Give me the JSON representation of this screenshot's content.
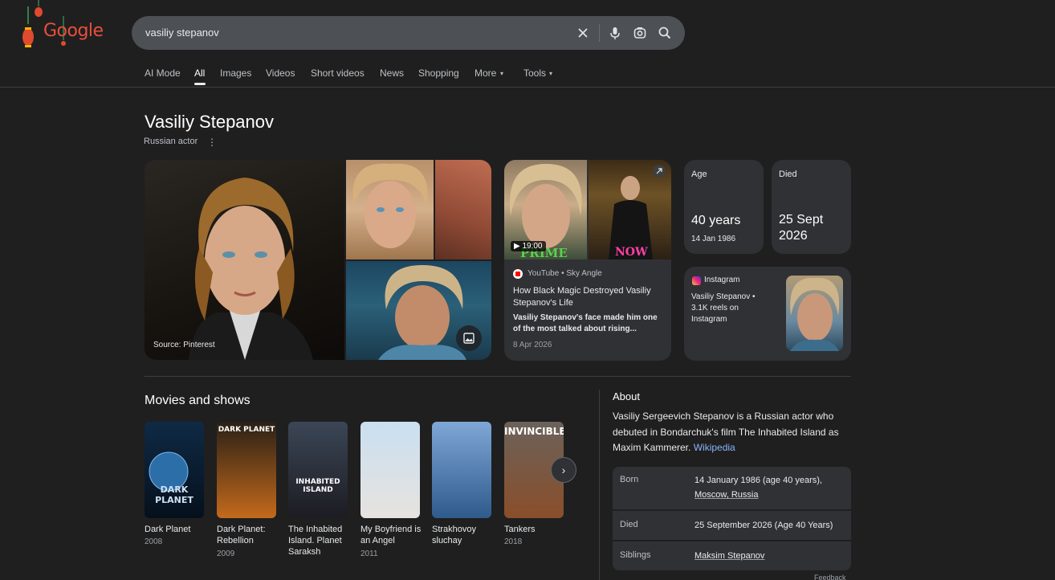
{
  "header": {
    "logo_text": "Google",
    "search_query": "vasiliy stepanov"
  },
  "tabs": [
    {
      "label": "AI Mode"
    },
    {
      "label": "All"
    },
    {
      "label": "Images"
    },
    {
      "label": "Videos"
    },
    {
      "label": "Short videos"
    },
    {
      "label": "News"
    },
    {
      "label": "Shopping"
    },
    {
      "label": "More"
    },
    {
      "label": "Tools"
    }
  ],
  "entity": {
    "name": "Vasiliy Stepanov",
    "subtitle": "Russian actor"
  },
  "images": {
    "source_label": "Source: Pinterest"
  },
  "video": {
    "duration": "19:00",
    "thumb_left_text": "PRIME",
    "thumb_right_text": "NOW",
    "source": "YouTube • Sky Angle",
    "title": "How Black Magic Destroyed Vasiliy Stepanov's Life",
    "snippet": "Vasiliy Stepanov's face made him one of the most talked about rising...",
    "date": "8 Apr 2026"
  },
  "stats": {
    "age_label": "Age",
    "age_value": "40 years",
    "age_sub": "14 Jan 1986",
    "died_label": "Died",
    "died_value_line1": "25 Sept",
    "died_value_line2": "2026"
  },
  "instagram": {
    "source": "Instagram",
    "text": "Vasiliy Stepanov • 3.1K reels on Instagram"
  },
  "movies": {
    "title": "Movies and shows",
    "items": [
      {
        "name": "Dark Planet",
        "year": "2008",
        "poster_text": "DARK PLANET",
        "color_top": "#0f2a45",
        "color_bottom": "#05101c"
      },
      {
        "name": "Dark Planet: Rebellion",
        "year": "2009",
        "poster_text": "DARK PLANET",
        "color_top": "#2a2016",
        "color_bottom": "#c46a1c"
      },
      {
        "name": "The Inhabited Island. Planet Saraksh",
        "year": "",
        "poster_text": "INHABITED ISLAND",
        "color_top": "#3b4656",
        "color_bottom": "#1c1c22"
      },
      {
        "name": "My Boyfriend is an Angel",
        "year": "2011",
        "poster_text": "",
        "color_top": "#c9dff0",
        "color_bottom": "#e7e3df"
      },
      {
        "name": "Strakhovoy sluchay",
        "year": "",
        "poster_text": "",
        "color_top": "#7fa7d6",
        "color_bottom": "#2f5a8c"
      },
      {
        "name": "Tankers",
        "year": "2018",
        "poster_text": "INVINCIBLE",
        "color_top": "#6b625a",
        "color_bottom": "#8a4e2a"
      }
    ]
  },
  "about": {
    "title": "About",
    "text": "Vasiliy Sergeevich Stepanov is a Russian actor who debuted in Bondarchuk's film The Inhabited Island as Maxim Kammerer.",
    "link": "Wikipedia"
  },
  "facts": [
    {
      "key": "Born",
      "value_line1": "14 January 1986 (age 40 years),",
      "value_line2": "Moscow, Russia"
    },
    {
      "key": "Died",
      "value_line1": "25 September 2026 (Age 40 Years)",
      "value_line2": ""
    },
    {
      "key": "Siblings",
      "value_line1": "Maksim Stepanov",
      "value_line2": ""
    }
  ],
  "footer": {
    "feedback": "Feedback"
  },
  "colors": {
    "background": "#1f1f1f",
    "card": "#303134",
    "link": "#8ab4f8",
    "logo": "#e84f3d"
  }
}
